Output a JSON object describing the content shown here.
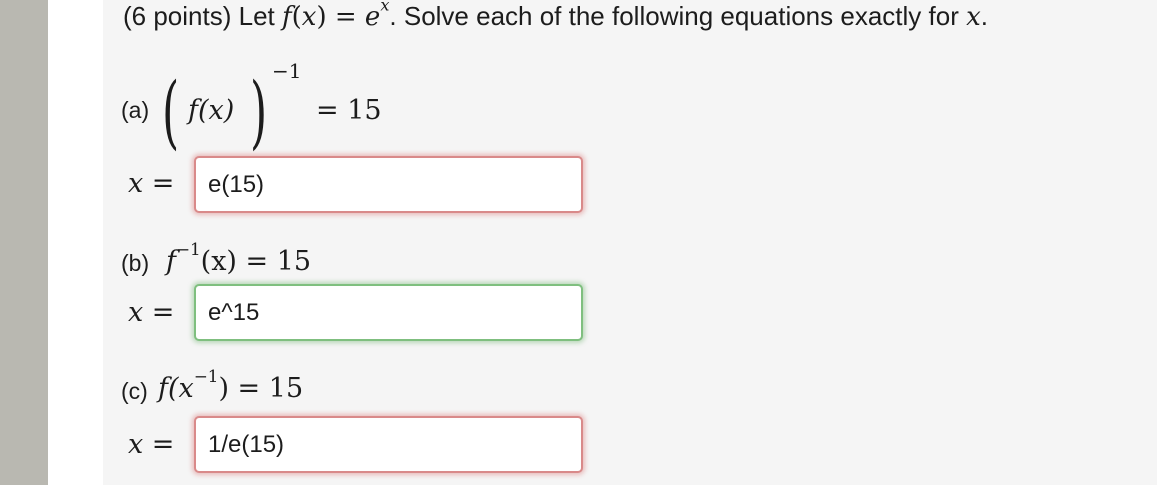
{
  "question": {
    "prefix": "(6 points) Let ",
    "f": "f",
    "open": "(",
    "x": "x",
    "close": ")",
    "equals": " = ",
    "e": "e",
    "exp": "x",
    "middle": ". Solve each of the following equations exactly for ",
    "var": "x",
    "period": "."
  },
  "parts": [
    {
      "label": "(a)",
      "eq_inner": "f(x)",
      "eq_exp": "−1",
      "eq_rhs": "= 15",
      "x_label": "x =",
      "answer": "e(15)",
      "status": "incorrect"
    },
    {
      "label": "(b)",
      "eq_f": "f",
      "eq_exp": "−1",
      "eq_rest": "(x) = 15",
      "x_label": "x =",
      "answer": "e^15",
      "status": "correct"
    },
    {
      "label": "(c)",
      "eq_pre": "f(x",
      "eq_exp": "−1",
      "eq_post": ") = 15",
      "x_label": "x =",
      "answer": "1/e(15)",
      "status": "incorrect"
    }
  ],
  "colors": {
    "incorrect_border": "#d98a8a",
    "correct_border": "#7fbf7f",
    "panel_bg": "#f5f5f5",
    "sidebar": "#b9b8b1"
  }
}
